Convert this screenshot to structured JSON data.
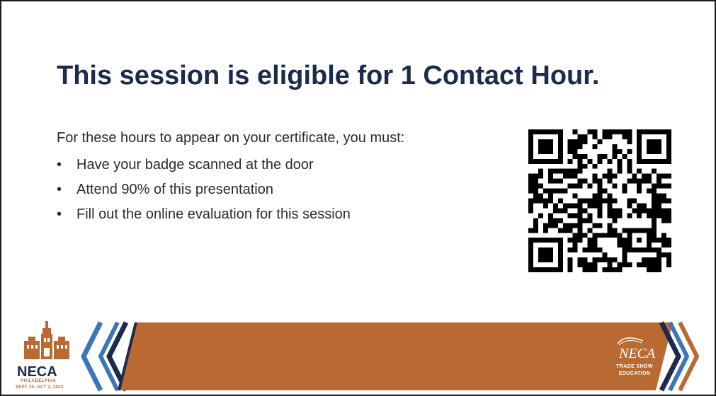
{
  "slide": {
    "title": "This session is eligible for 1 Contact Hour.",
    "intro": "For these hours to appear on your certificate, you must:",
    "bullets": [
      {
        "marker": "•",
        "text": "Have your badge scanned at the door"
      },
      {
        "marker": "•",
        "text": "Attend 90% of this presentation"
      },
      {
        "marker": "•",
        "text": "Fill out the online evaluation for this session"
      }
    ]
  },
  "footer": {
    "left_logo": {
      "name": "NECA",
      "city": "PHILADELPHIA",
      "dates": "SEPT 29–OCT 2, 2023"
    },
    "right_logo": {
      "name": "NECA",
      "line1": "TRADE SHOW",
      "line2": "EDUCATION"
    }
  },
  "colors": {
    "title": "#1b2a4d",
    "banner": "#b96a33",
    "chevron_navy": "#1b2a4d",
    "chevron_blue": "#3b76b8"
  },
  "icons": {
    "qr": "qr-code",
    "left_logo": "philadelphia-skyline-logo",
    "right_logo": "neca-flag-logo"
  }
}
